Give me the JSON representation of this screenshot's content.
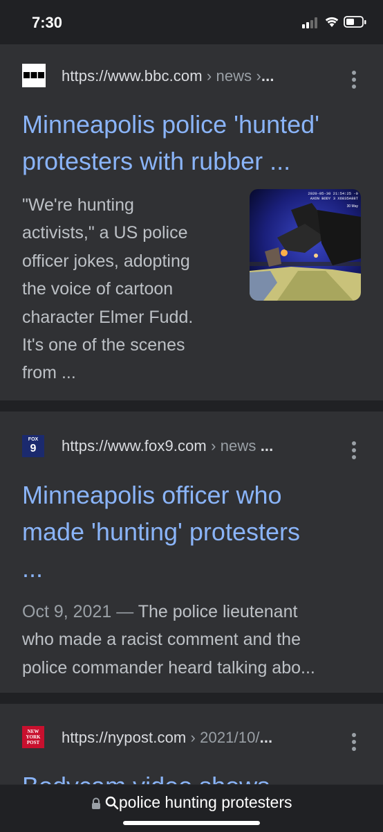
{
  "status_bar": {
    "time": "7:30"
  },
  "results": [
    {
      "url": "https://www.bbc.com",
      "path": " › news ›",
      "ellipsis": "...",
      "title_line1": "Minneapolis police 'hunted'",
      "title_line2": "protesters with rubber ...",
      "snippet_lines": [
        "\"We're hunting",
        "activists,\" a US police",
        "officer jokes, adopting",
        "the voice of cartoon",
        "character Elmer Fudd.",
        "It's one of the scenes",
        "from ..."
      ],
      "thumbnail_text": [
        "2020-05-30 21:54:25 -0",
        "AXON BODY 3 X6835A88T",
        "30 May"
      ]
    },
    {
      "url": "https://www.fox9.com",
      "path": " › news ",
      "ellipsis": "...",
      "favicon_text_top": "FOX",
      "favicon_text_bottom": "9",
      "title_line1": "Minneapolis officer who",
      "title_line2": "made 'hunting' protesters",
      "title_line3": "...",
      "date": "Oct 9, 2021",
      "dash": " — ",
      "snippet_line1": "The police lieutenant",
      "snippet_line2": "who made a racist comment and the",
      "snippet_line3": "police commander heard talking abo..."
    },
    {
      "url": "https://nypost.com",
      "path": " › 2021/10/",
      "ellipsis": "...",
      "favicon_text": "NEW YORK POST",
      "title_partial": "Bodycam video shows"
    }
  ],
  "address_bar": {
    "query": "police hunting protesters"
  },
  "colors": {
    "background": "#202124",
    "card": "#303134",
    "link": "#8ab4f8",
    "text": "#bdc1c6"
  }
}
